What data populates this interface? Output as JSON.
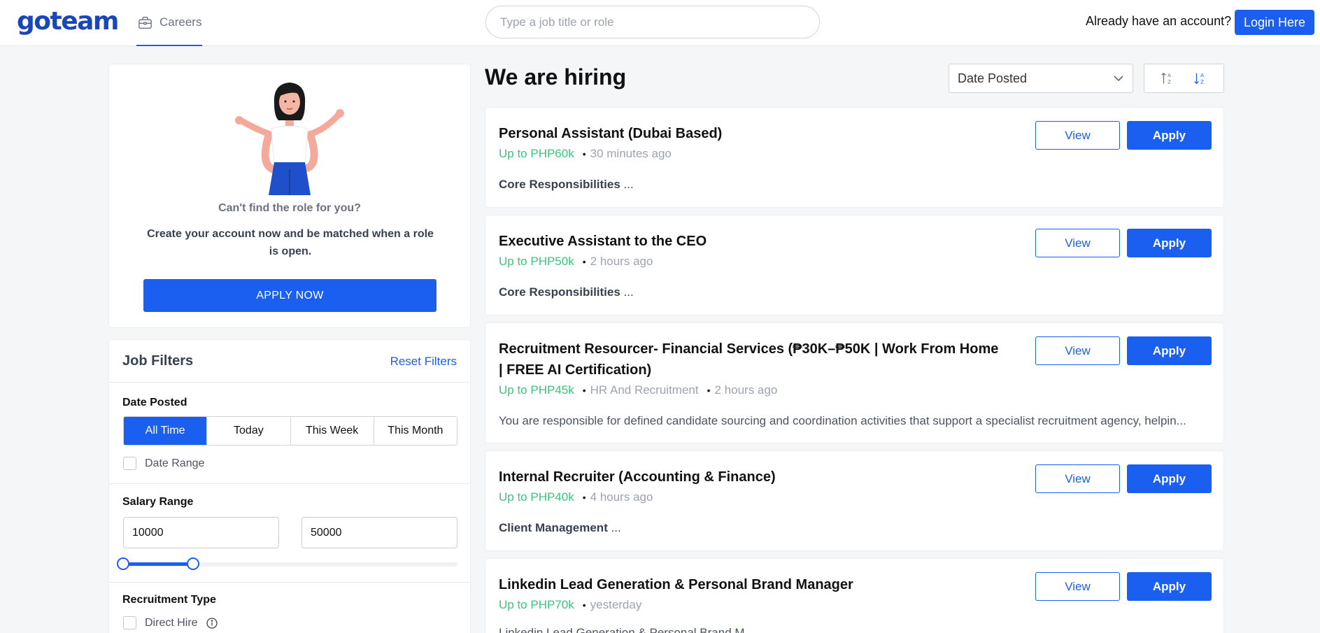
{
  "header": {
    "logo": "goteam",
    "nav_careers": "Careers",
    "search_placeholder": "Type a job title or role",
    "account_text": "Already have an account?",
    "login_label": "Login Here"
  },
  "promo": {
    "question": "Can't find the role for you?",
    "text": "Create your account now and be matched when a role is open.",
    "button": "APPLY NOW"
  },
  "filters": {
    "title": "Job Filters",
    "reset": "Reset Filters",
    "date_posted_label": "Date Posted",
    "date_options": [
      "All Time",
      "Today",
      "This Week",
      "This Month"
    ],
    "date_selected": "All Time",
    "date_range_label": "Date Range",
    "salary_label": "Salary Range",
    "salary_min": "10000",
    "salary_max": "50000",
    "recruitment_label": "Recruitment Type",
    "direct_hire_label": "Direct Hire"
  },
  "main": {
    "heading": "We are hiring",
    "sort_value": "Date Posted",
    "view_label": "View",
    "apply_label": "Apply",
    "jobs": [
      {
        "title": "Personal Assistant (Dubai Based)",
        "salary": "Up to PHP60k",
        "category": "",
        "time": "30 minutes ago",
        "snippet_bold": "Core Responsibilities",
        "snippet_rest": " ...",
        "snippet_plain": ""
      },
      {
        "title": "Executive Assistant to the CEO",
        "salary": "Up to PHP50k",
        "category": "",
        "time": "2 hours ago",
        "snippet_bold": "Core Responsibilities",
        "snippet_rest": " ...",
        "snippet_plain": ""
      },
      {
        "title": "Recruitment Resourcer- Financial Services (₱30K–₱50K | Work From Home | FREE AI Certification)",
        "salary": "Up to PHP45k",
        "category": "HR And Recruitment",
        "time": "2 hours ago",
        "snippet_bold": "",
        "snippet_rest": "",
        "snippet_plain": "You are responsible for defined candidate sourcing and coordination activities that support a specialist recruitment agency, helpin..."
      },
      {
        "title": "Internal Recruiter (Accounting & Finance)",
        "salary": "Up to PHP40k",
        "category": "",
        "time": "4 hours ago",
        "snippet_bold": "Client Management",
        "snippet_rest": " ...",
        "snippet_plain": ""
      },
      {
        "title": "Linkedin Lead Generation & Personal Brand Manager",
        "salary": "Up to PHP70k",
        "category": "",
        "time": "yesterday",
        "snippet_bold": "",
        "snippet_rest": "",
        "snippet_plain": "Linkedin Lead Generation & Personal Brand M..."
      }
    ]
  },
  "colors": {
    "primary": "#1a5ff0",
    "salary": "#3cc47c",
    "logo": "#1a47b8"
  }
}
